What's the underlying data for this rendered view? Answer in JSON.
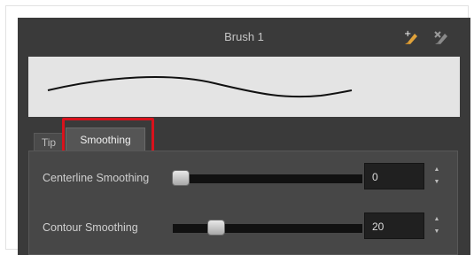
{
  "brush": {
    "title": "Brush 1",
    "icons": [
      "new-brush-icon",
      "delete-brush-icon"
    ]
  },
  "tabs": [
    {
      "label": "Tip",
      "active": false
    },
    {
      "label": "Smoothing",
      "active": true
    }
  ],
  "smoothing": {
    "centerline": {
      "label": "Centerline Smoothing",
      "value": "0",
      "slider_fraction": 0.0
    },
    "contour": {
      "label": "Contour Smoothing",
      "value": "20",
      "slider_fraction": 0.2
    }
  },
  "colors": {
    "panel": "#3a3a3a",
    "highlight": "#d9121c"
  }
}
